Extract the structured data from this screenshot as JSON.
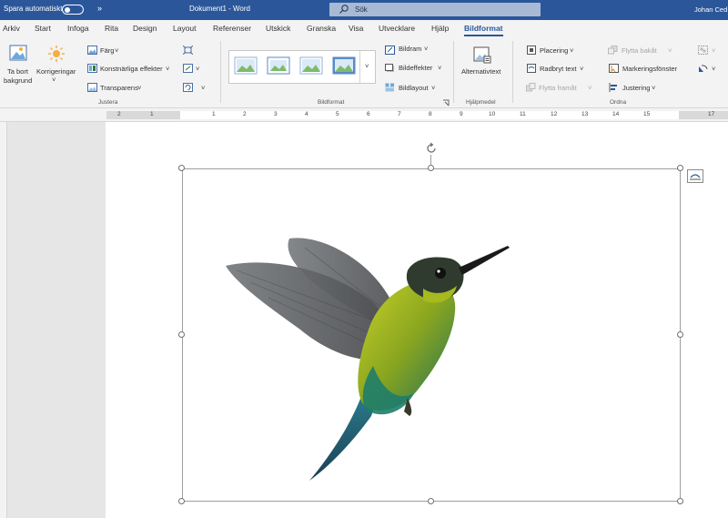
{
  "titlebar": {
    "autosave_label": "Spara automatiskt",
    "more_glyph": "»",
    "doc_title": "Dokument1  -  Word",
    "search_placeholder": "Sök",
    "user": "Johan Ced"
  },
  "tabs": [
    {
      "label": "Arkiv"
    },
    {
      "label": "Start"
    },
    {
      "label": "Infoga"
    },
    {
      "label": "Rita"
    },
    {
      "label": "Design"
    },
    {
      "label": "Layout"
    },
    {
      "label": "Referenser"
    },
    {
      "label": "Utskick"
    },
    {
      "label": "Granska"
    },
    {
      "label": "Visa"
    },
    {
      "label": "Utvecklare"
    },
    {
      "label": "Hjälp"
    },
    {
      "label": "Bildformat",
      "active": true
    }
  ],
  "ribbon": {
    "justera": {
      "remove_bg_line1": "Ta bort",
      "remove_bg_line2": "bakgrund",
      "corrections": "Korrigeringar",
      "color": "Färg",
      "artistic": "Konstnärliga effekter",
      "transparency": "Transparens",
      "group_label": "Justera"
    },
    "bildformat": {
      "border": "Bildram",
      "effects": "Bildeffekter",
      "layout": "Bildlayout",
      "group_label": "Bildformat"
    },
    "hjalpmedel": {
      "alt_text": "Alternativtext",
      "group_label": "Hjälpmedel"
    },
    "ordna": {
      "position": "Placering",
      "wrap_text": "Radbryt text",
      "bring_forward": "Flytta framåt",
      "send_backward": "Flytta bakåt",
      "selection_pane": "Markeringsfönster",
      "align": "Justering",
      "group_label": "Ordna"
    },
    "dropdown_glyph": "˅"
  },
  "ruler": {
    "marks": [
      "2",
      "1",
      "1",
      "2",
      "3",
      "4",
      "5",
      "6",
      "7",
      "8",
      "9",
      "10",
      "11",
      "12",
      "13",
      "14",
      "15",
      "17"
    ]
  },
  "colors": {
    "accent": "#2b579a",
    "ribbon_bg": "#f3f3f3",
    "search_bg": "#a7b9d4"
  }
}
